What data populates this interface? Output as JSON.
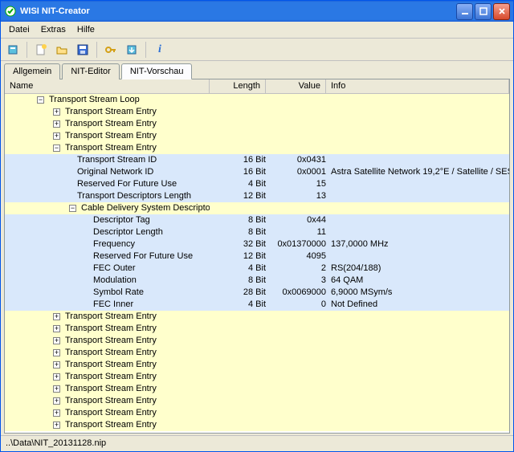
{
  "window": {
    "title": "WISI  NIT-Creator"
  },
  "menu": [
    "Datei",
    "Extras",
    "Hilfe"
  ],
  "tabs": [
    "Allgemein",
    "NIT-Editor",
    "NIT-Vorschau"
  ],
  "columns": {
    "name": "Name",
    "length": "Length",
    "value": "Value",
    "info": "Info"
  },
  "statusbar": {
    "path": "..\\Data\\NIT_20131128.nip"
  },
  "rows": [
    {
      "indent": 2,
      "expander": "-",
      "cls": "yellow",
      "name": "Transport Stream Loop"
    },
    {
      "indent": 3,
      "expander": "+",
      "cls": "yellow",
      "name": "Transport Stream Entry"
    },
    {
      "indent": 3,
      "expander": "+",
      "cls": "yellow",
      "name": "Transport Stream Entry"
    },
    {
      "indent": 3,
      "expander": "+",
      "cls": "yellow",
      "name": "Transport Stream Entry"
    },
    {
      "indent": 3,
      "expander": "-",
      "cls": "yellow",
      "name": "Transport Stream Entry"
    },
    {
      "indent": 4,
      "leaf": true,
      "cls": "blue",
      "name": "Transport Stream ID",
      "length": "16 Bit",
      "value": "0x0431"
    },
    {
      "indent": 4,
      "leaf": true,
      "cls": "blue",
      "name": "Original Network ID",
      "length": "16 Bit",
      "value": "0x0001",
      "info": "Astra Satellite Network 19,2°E / Satellite / SES"
    },
    {
      "indent": 4,
      "leaf": true,
      "cls": "blue",
      "name": "Reserved For Future Use",
      "length": "4 Bit",
      "value": "15"
    },
    {
      "indent": 4,
      "leaf": true,
      "cls": "blue",
      "name": "Transport Descriptors Length",
      "length": "12 Bit",
      "value": "13"
    },
    {
      "indent": 4,
      "expander": "-",
      "cls": "yellow",
      "name": "Cable Delivery System Descriptor"
    },
    {
      "indent": 5,
      "leaf": true,
      "cls": "blue",
      "name": "Descriptor Tag",
      "length": "8 Bit",
      "value": "0x44"
    },
    {
      "indent": 5,
      "leaf": true,
      "cls": "blue",
      "name": "Descriptor Length",
      "length": "8 Bit",
      "value": "11"
    },
    {
      "indent": 5,
      "leaf": true,
      "cls": "blue",
      "name": "Frequency",
      "length": "32 Bit",
      "value": "0x01370000",
      "info": "137,0000 MHz"
    },
    {
      "indent": 5,
      "leaf": true,
      "cls": "blue",
      "name": "Reserved For Future Use",
      "length": "12 Bit",
      "value": "4095"
    },
    {
      "indent": 5,
      "leaf": true,
      "cls": "blue",
      "name": "FEC Outer",
      "length": "4 Bit",
      "value": "2",
      "info": "RS(204/188)"
    },
    {
      "indent": 5,
      "leaf": true,
      "cls": "blue",
      "name": "Modulation",
      "length": "8 Bit",
      "value": "3",
      "info": "64 QAM"
    },
    {
      "indent": 5,
      "leaf": true,
      "cls": "blue",
      "name": "Symbol Rate",
      "length": "28 Bit",
      "value": "0x0069000",
      "info": "6,9000 MSym/s"
    },
    {
      "indent": 5,
      "leaf": true,
      "cls": "blue",
      "name": "FEC Inner",
      "length": "4 Bit",
      "value": "0",
      "info": "Not Defined"
    },
    {
      "indent": 3,
      "expander": "+",
      "cls": "yellow",
      "name": "Transport Stream Entry"
    },
    {
      "indent": 3,
      "expander": "+",
      "cls": "yellow",
      "name": "Transport Stream Entry"
    },
    {
      "indent": 3,
      "expander": "+",
      "cls": "yellow",
      "name": "Transport Stream Entry"
    },
    {
      "indent": 3,
      "expander": "+",
      "cls": "yellow",
      "name": "Transport Stream Entry"
    },
    {
      "indent": 3,
      "expander": "+",
      "cls": "yellow",
      "name": "Transport Stream Entry"
    },
    {
      "indent": 3,
      "expander": "+",
      "cls": "yellow",
      "name": "Transport Stream Entry"
    },
    {
      "indent": 3,
      "expander": "+",
      "cls": "yellow",
      "name": "Transport Stream Entry"
    },
    {
      "indent": 3,
      "expander": "+",
      "cls": "yellow",
      "name": "Transport Stream Entry"
    },
    {
      "indent": 3,
      "expander": "+",
      "cls": "yellow",
      "name": "Transport Stream Entry"
    },
    {
      "indent": 3,
      "expander": "+",
      "cls": "yellow",
      "name": "Transport Stream Entry"
    }
  ]
}
